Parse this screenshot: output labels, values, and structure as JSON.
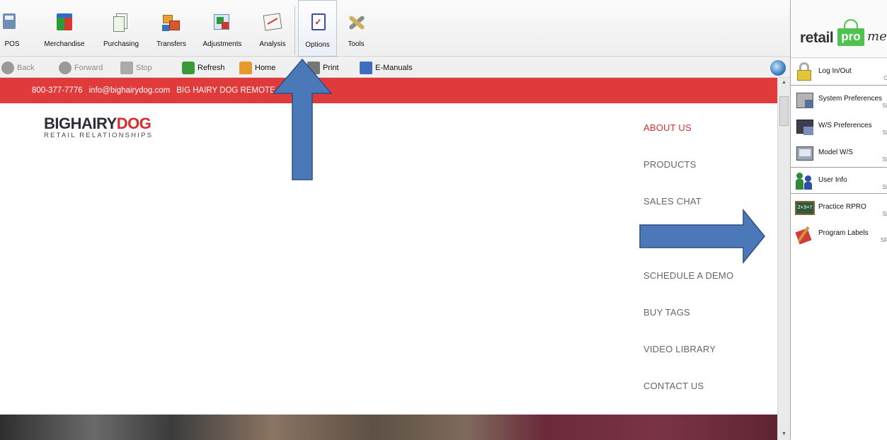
{
  "toolbar": {
    "items": [
      {
        "label": "POS"
      },
      {
        "label": "Merchandise"
      },
      {
        "label": "Purchasing"
      },
      {
        "label": "Transfers"
      },
      {
        "label": "Adjustments"
      },
      {
        "label": "Analysis"
      },
      {
        "label": "Options"
      },
      {
        "label": "Tools"
      }
    ]
  },
  "navbar": {
    "back": "Back",
    "forward": "Forward",
    "stop": "Stop",
    "refresh": "Refresh",
    "home": "Home",
    "print": "Print",
    "emanuals": "E-Manuals"
  },
  "site": {
    "phone": "800-377-7776",
    "email": "info@bighairydog.com",
    "remote": "BIG HAIRY DOG REMOTE SUPPORT",
    "logo_part1": "BIGHAIRY",
    "logo_part2": "DOG",
    "logo_tagline": "RETAIL RELATIONSHIPS",
    "menu": [
      {
        "label": "ABOUT US"
      },
      {
        "label": "PRODUCTS"
      },
      {
        "label": "SALES CHAT"
      },
      {
        "label": "SCHEDULE A DEMO"
      },
      {
        "label": "BUY TAGS"
      },
      {
        "label": "VIDEO LIBRARY"
      },
      {
        "label": "CONTACT US"
      }
    ]
  },
  "side": {
    "brand_retail": "retail",
    "brand_pro": "pro",
    "brand_me": "me",
    "items": [
      {
        "label": "Log In/Out",
        "shortcut": "C"
      },
      {
        "label": "System Preferences",
        "shortcut": "SI"
      },
      {
        "label": "W/S Preferences",
        "shortcut": "SI"
      },
      {
        "label": "Model W/S",
        "shortcut": "SI"
      },
      {
        "label": "User Info",
        "shortcut": "SI"
      },
      {
        "label": "Practice RPRO",
        "shortcut": "SI"
      },
      {
        "label": "Program Labels",
        "shortcut": "SF"
      }
    ]
  },
  "colors": {
    "accent_red": "#e03a3a",
    "arrow_blue": "#4a78b8",
    "brand_green": "#4fc24f"
  }
}
